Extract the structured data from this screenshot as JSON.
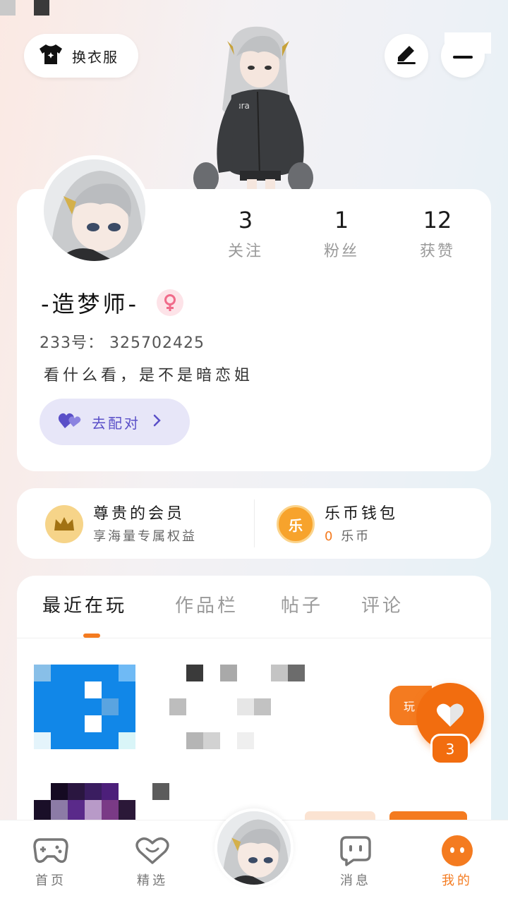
{
  "header": {
    "outfit_label": "换衣服"
  },
  "profile": {
    "stats": [
      {
        "value": "3",
        "label": "关注"
      },
      {
        "value": "1",
        "label": "粉丝"
      },
      {
        "value": "12",
        "label": "获赞"
      }
    ],
    "nickname": "-造梦师-",
    "uid_prefix": "233号：",
    "uid": "325702425",
    "bio": "看什么看，是不是暗恋姐",
    "match_label": "去配对"
  },
  "vip": {
    "member_title": "尊贵的会员",
    "member_sub": "享海量专属权益",
    "wallet_icon_text": "乐",
    "wallet_title": "乐币钱包",
    "wallet_amount": "0",
    "wallet_unit": "乐币"
  },
  "tabs": [
    {
      "label": "最近在玩",
      "active": true
    },
    {
      "label": "作品栏",
      "active": false
    },
    {
      "label": "帖子",
      "active": false
    },
    {
      "label": "评论",
      "active": false
    }
  ],
  "floating": {
    "side_tag": "玩",
    "like_count": "3"
  },
  "bottom_nav": [
    {
      "label": "首页",
      "icon": "gamepad-icon"
    },
    {
      "label": "精选",
      "icon": "heart-tv-icon"
    },
    {
      "label": "消息",
      "icon": "chat-icon"
    },
    {
      "label": "我的",
      "icon": "profile-face-icon",
      "active": true
    }
  ],
  "colors": {
    "accent": "#f47b20",
    "match": "#5a4fc8",
    "gender_female": "#f06b8a"
  }
}
